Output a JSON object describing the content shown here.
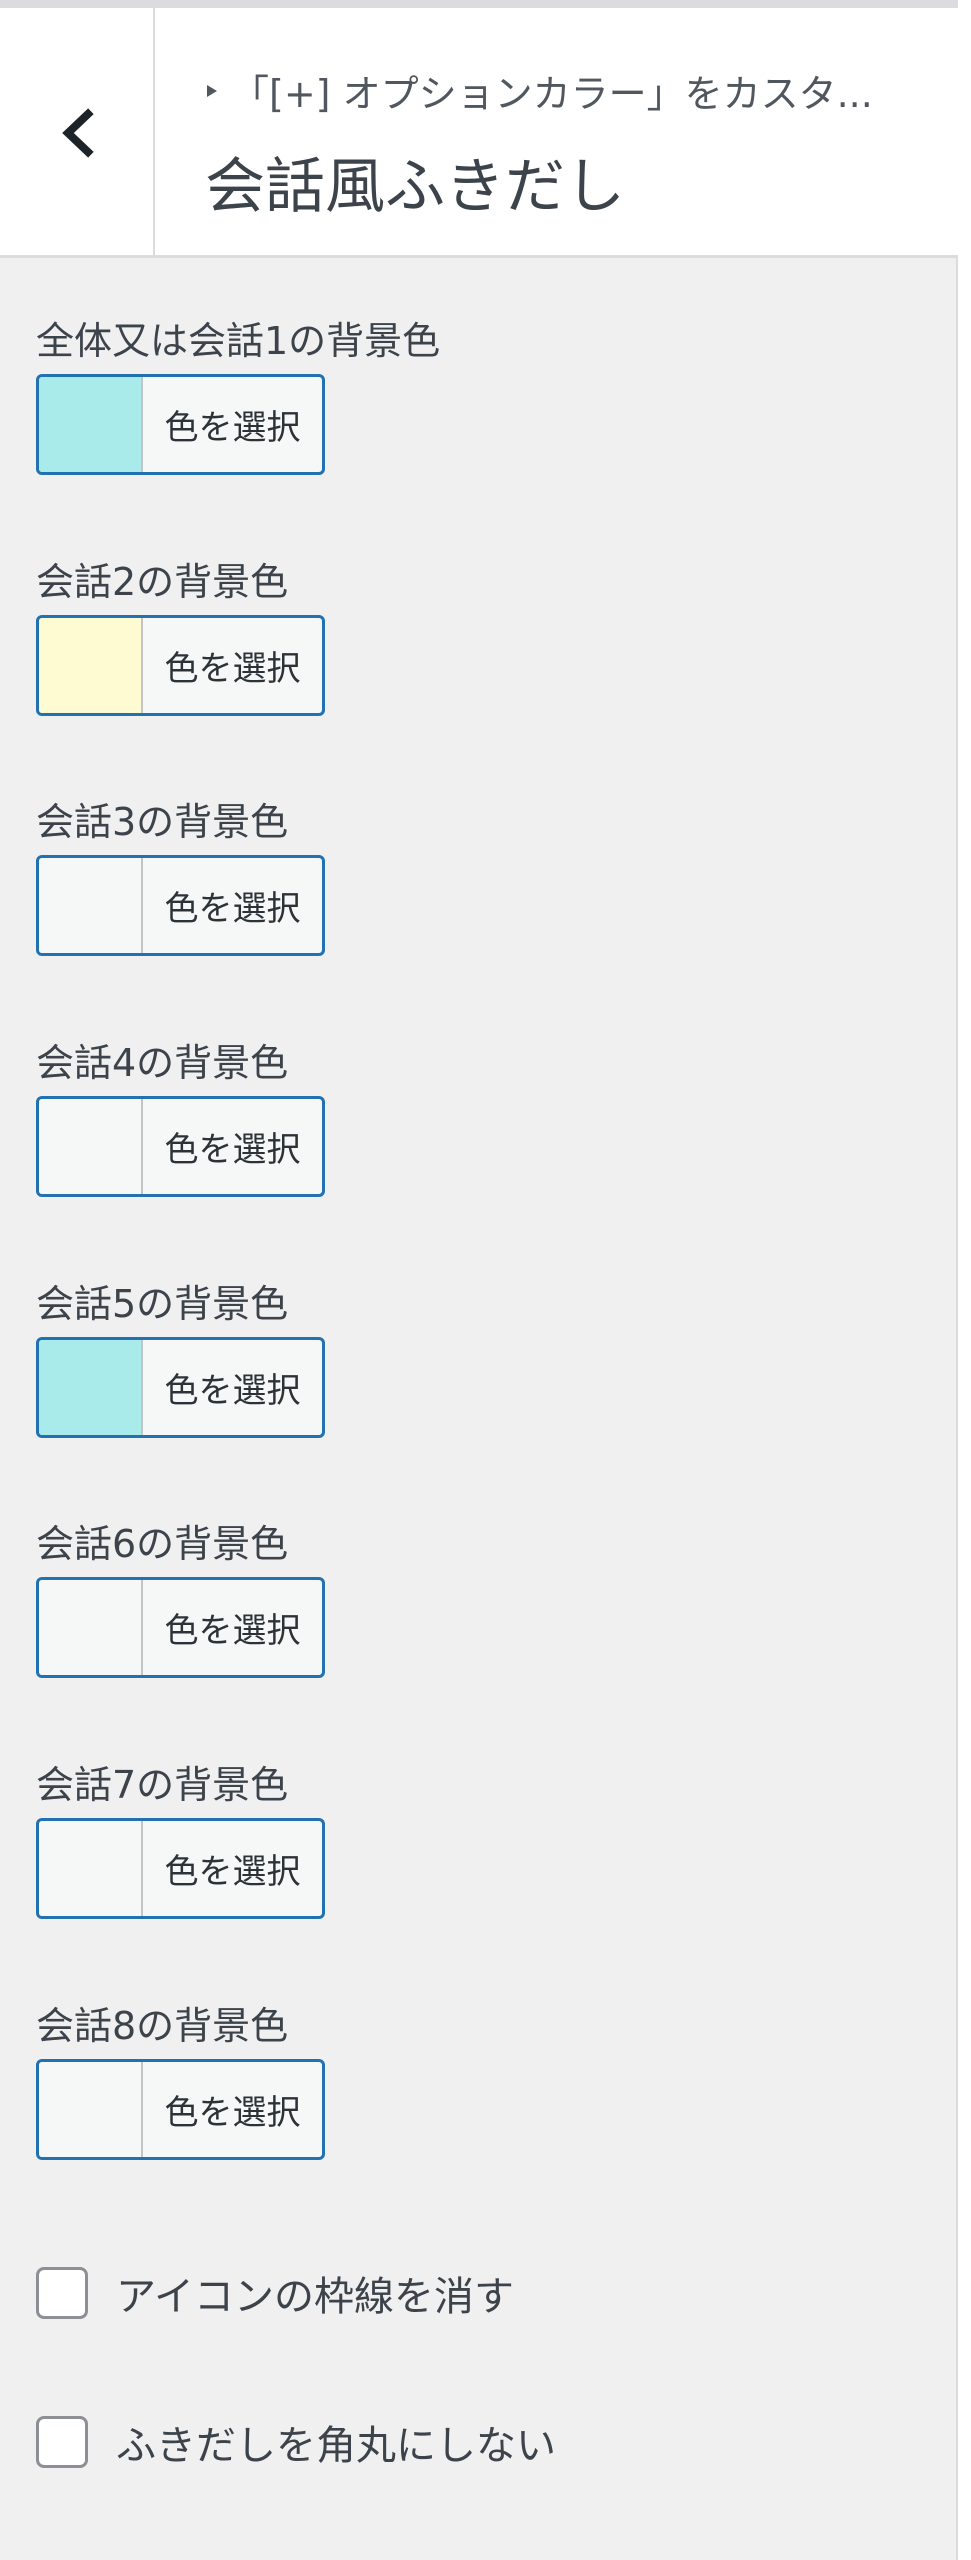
{
  "header": {
    "breadcrumb": "「[+] オプションカラー」をカスタ...",
    "title": "会話風ふきだし"
  },
  "color_settings": [
    {
      "label": "全体又は会話1の背景色",
      "button": "色を選択",
      "color": "#a9eaeb"
    },
    {
      "label": "会話2の背景色",
      "button": "色を選択",
      "color": "#fefad2"
    },
    {
      "label": "会話3の背景色",
      "button": "色を選択",
      "color": "#f6f7f7"
    },
    {
      "label": "会話4の背景色",
      "button": "色を選択",
      "color": "#f6f7f7"
    },
    {
      "label": "会話5の背景色",
      "button": "色を選択",
      "color": "#a9eaeb"
    },
    {
      "label": "会話6の背景色",
      "button": "色を選択",
      "color": "#f6f7f7"
    },
    {
      "label": "会話7の背景色",
      "button": "色を選択",
      "color": "#f6f7f7"
    },
    {
      "label": "会話8の背景色",
      "button": "色を選択",
      "color": "#f6f7f7"
    }
  ],
  "checkboxes": [
    {
      "label": "アイコンの枠線を消す",
      "checked": false
    },
    {
      "label": "ふきだしを角丸にしない",
      "checked": false
    }
  ],
  "colors": {
    "accent": "#2271b1",
    "panel_bg": "#f0f0f1",
    "text": "#3c434a"
  }
}
